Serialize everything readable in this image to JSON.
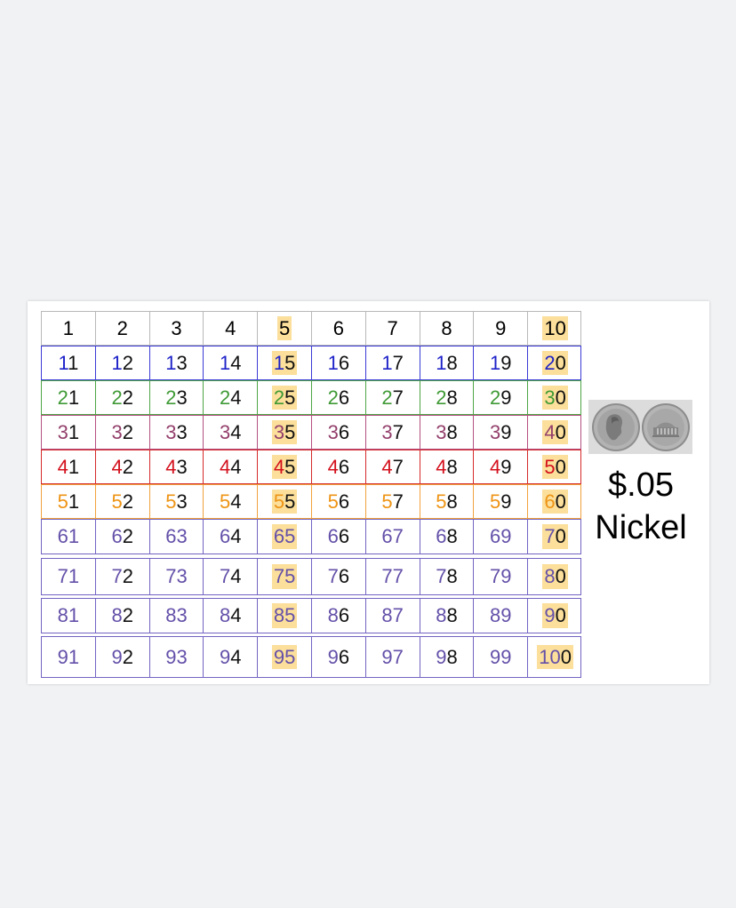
{
  "hundred_chart": {
    "rows": [
      {
        "cells": [
          "1",
          "2",
          "3",
          "4",
          "5",
          "6",
          "7",
          "8",
          "9",
          "10"
        ],
        "tens_color": "#000000",
        "line_color": "#b8b8b8"
      },
      {
        "cells": [
          "11",
          "12",
          "13",
          "14",
          "15",
          "16",
          "17",
          "18",
          "19",
          "20"
        ],
        "tens_color": "#1f23c8",
        "line_color": "#3b3bd6"
      },
      {
        "cells": [
          "21",
          "22",
          "23",
          "24",
          "25",
          "26",
          "27",
          "28",
          "29",
          "30"
        ],
        "tens_color": "#3f9a35",
        "line_color": "#4ea545"
      },
      {
        "cells": [
          "31",
          "32",
          "33",
          "34",
          "35",
          "36",
          "37",
          "38",
          "39",
          "40"
        ],
        "tens_color": "#933f6b",
        "line_color": "#b55080"
      },
      {
        "cells": [
          "41",
          "42",
          "43",
          "44",
          "45",
          "46",
          "47",
          "48",
          "49",
          "50"
        ],
        "tens_color": "#d3101c",
        "line_color": "#d52a2a"
      },
      {
        "cells": [
          "51",
          "52",
          "53",
          "54",
          "55",
          "56",
          "57",
          "58",
          "59",
          "60"
        ],
        "tens_color": "#ee9415",
        "line_color": "#f1a23c"
      },
      {
        "cells": [
          "61",
          "62",
          "63",
          "64",
          "65",
          "66",
          "67",
          "68",
          "69",
          "70"
        ],
        "tens_color": "#6450a9",
        "line_color": "#7264c2"
      },
      {
        "cells": [
          "71",
          "72",
          "73",
          "74",
          "75",
          "76",
          "77",
          "78",
          "79",
          "80"
        ],
        "tens_color": "#6450a9",
        "line_color": "#7264c2"
      },
      {
        "cells": [
          "81",
          "82",
          "83",
          "84",
          "85",
          "86",
          "87",
          "88",
          "89",
          "90"
        ],
        "tens_color": "#6450a9",
        "line_color": "#7264c2"
      },
      {
        "cells": [
          "91",
          "92",
          "93",
          "94",
          "95",
          "96",
          "97",
          "98",
          "99",
          "100"
        ],
        "tens_color": "#6450a9",
        "line_color": "#7264c2"
      }
    ],
    "highlight_color": "#fbdf9b"
  },
  "coin": {
    "price": "$.05",
    "name": "Nickel",
    "image": "nickel-coin-front-and-back"
  }
}
